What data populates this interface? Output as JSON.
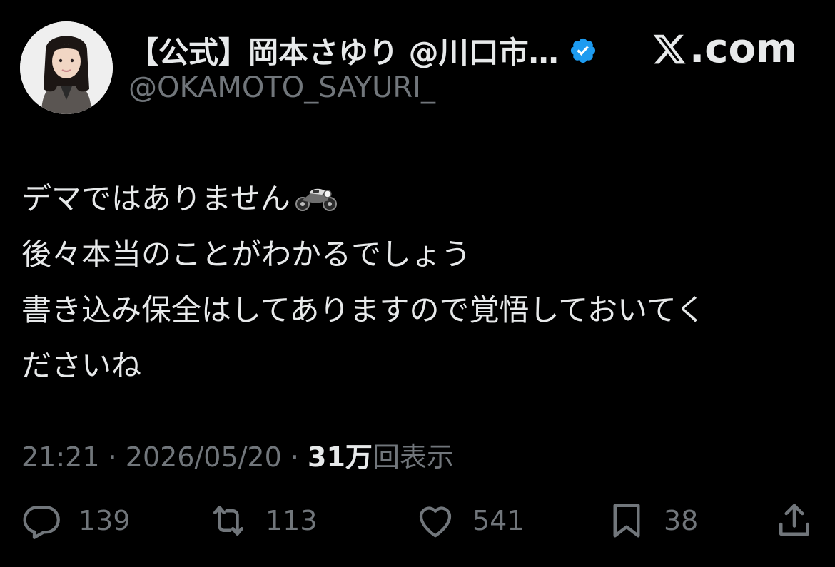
{
  "author": {
    "display_name": "【公式】岡本さゆり @川口市…",
    "handle": "@OKAMOTO_SAYURI_",
    "verified_icon": "verified-badge-icon",
    "avatar_icon": "profile-photo-avatar"
  },
  "brand": {
    "text": ".com",
    "logo_icon": "x-logo-icon"
  },
  "tweet": {
    "lines": [
      "デマではありません",
      "後々本当のことがわかるでしょう",
      "書き込み保全はしてありますので覚悟しておいてく",
      "ださいね"
    ],
    "emoji_icon": "motorcycle-emoji-icon"
  },
  "meta": {
    "time": "21:21",
    "separator": " · ",
    "date": "2026/05/20",
    "views_count": "31万",
    "views_label": "回表示"
  },
  "actions": {
    "replies": "139",
    "reposts": "113",
    "likes": "541",
    "bookmarks": "38"
  },
  "colors": {
    "background": "#000000",
    "text_primary": "#e7e9ea",
    "text_secondary": "#71767b",
    "verified_blue": "#1d9bf0"
  }
}
